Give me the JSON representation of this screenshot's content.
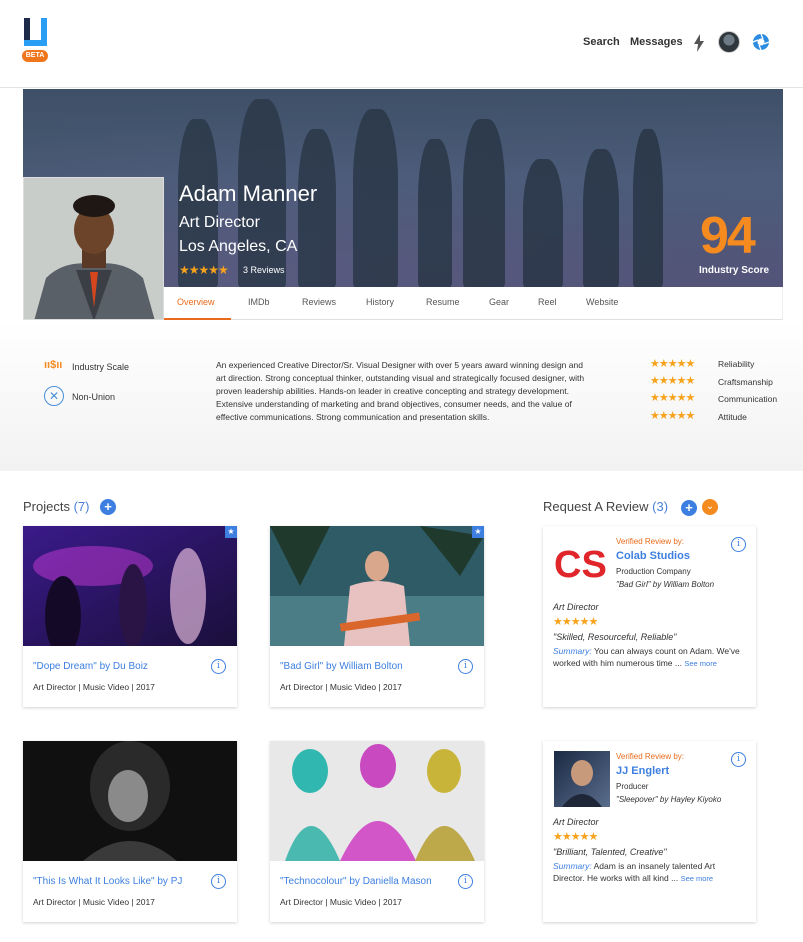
{
  "nav": {
    "logo_badge": "BETA",
    "search": "Search",
    "messages": "Messages"
  },
  "profile": {
    "name": "Adam Manner",
    "title": "Art Director",
    "location": "Los Angeles, CA",
    "stars": "★★★★★",
    "reviews": "3 Reviews",
    "score": "94",
    "score_label": "Industry Score"
  },
  "tabs": [
    "Overview",
    "IMDb",
    "Reviews",
    "History",
    "Resume",
    "Gear",
    "Reel",
    "Website"
  ],
  "info": {
    "scale_icon": "ıı$ıı",
    "scale_label": "Industry Scale",
    "union_label": "Non-Union",
    "bio": "An experienced Creative Director/Sr. Visual Designer with over 5 years award winning design and art direction. Strong conceptual thinker, outstanding visual and strategically focused designer, with proven leadership abilities. Hands-on leader in creative concepting and strategy development. Extensive understanding of marketing and brand objectives, consumer needs, and the value of effective communications. Strong communication and presentation skills.",
    "ratings": [
      {
        "label": "Reliability",
        "stars": "★★★★★"
      },
      {
        "label": "Craftsmanship",
        "stars": "★★★★★"
      },
      {
        "label": "Communication",
        "stars": "★★★★★"
      },
      {
        "label": "Attitude",
        "stars": "★★★★★"
      }
    ]
  },
  "projects": {
    "heading": "Projects",
    "count": "(7)",
    "items": [
      {
        "title": "\"Dope Dream\" by Du Boiz",
        "meta": "Art Director | Music Video | 2017"
      },
      {
        "title": "\"Bad Girl\" by William Bolton",
        "meta": "Art Director | Music Video | 2017"
      },
      {
        "title": "\"This Is What It Looks Like\" by PJ",
        "meta": "Art Director | Music Video | 2017"
      },
      {
        "title": "\"Technocolour\" by Daniella Mason",
        "meta": "Art Director | Music Video | 2017"
      }
    ]
  },
  "review_section": {
    "heading": "Request A Review",
    "count": "(3)",
    "items": [
      {
        "verified": "Verified Review by:",
        "name": "Colab Studios",
        "role": "Production Company",
        "project": "\"Bad Girl\" by William Bolton",
        "position": "Art Director",
        "stars": "★★★★★",
        "quote": "\"Skilled, Resourceful, Reliable\"",
        "summary_label": "Summary:",
        "summary": "You can always count on Adam. We've worked with him numerous time ...",
        "see_more": "See more",
        "logo_text": "CS"
      },
      {
        "verified": "Verified Review by:",
        "name": "JJ Englert",
        "role": "Producer",
        "project": "\"Sleepover\" by Hayley Kiyoko",
        "position": "Art Director",
        "stars": "★★★★★",
        "quote": "\"Brilliant, Talented, Creative\"",
        "summary_label": "Summary:",
        "summary": "Adam is an insanely talented Art Director. He works with all kind ...",
        "see_more": "See more"
      }
    ]
  },
  "colors": {
    "accent_orange": "#f58a1f",
    "link_blue": "#3d7fe0"
  }
}
